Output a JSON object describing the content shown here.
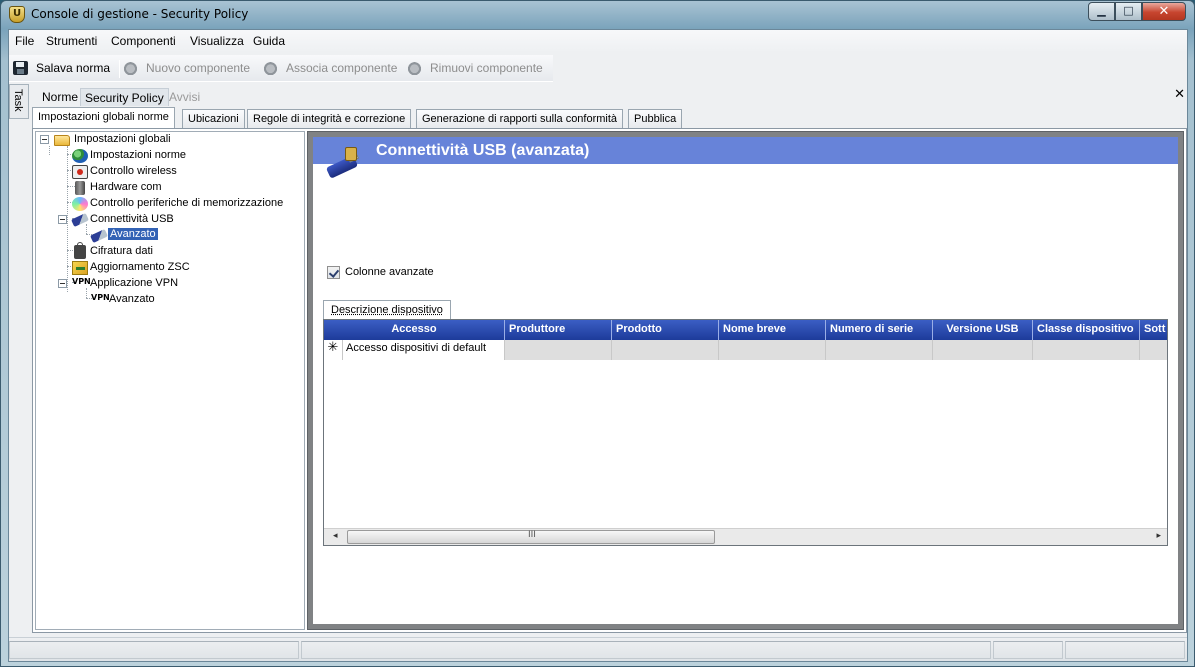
{
  "window": {
    "title": "Console di gestione  - Security Policy",
    "minimize_glyph": "▁",
    "maximize_glyph": "□",
    "close_glyph": "✕"
  },
  "menu": {
    "file": "File",
    "tools": "Strumenti",
    "components": "Componenti",
    "view": "Visualizza",
    "help": "Guida"
  },
  "toolbar": {
    "save": "Salava norma",
    "new_component": "Nuovo componente",
    "associate_component": "Associa componente",
    "remove_component": "Rimuovi componente"
  },
  "task_strip": "Task",
  "doc_tabs": {
    "policies": "Norme",
    "security_policy": "Security Policy",
    "alerts": "Avvisi",
    "close_glyph": "✕"
  },
  "tabs": {
    "global": "Impostazioni globali norme",
    "locations": "Ubicazioni",
    "integrity": "Regole di integrità e correzione",
    "compliance": "Generazione di rapporti sulla conformità",
    "publish": "Pubblica"
  },
  "tree": {
    "root": "Impostazioni globali",
    "policy_settings": "Impostazioni norme",
    "wireless": "Controllo wireless",
    "hardware": "Hardware com",
    "storage": "Controllo periferiche di memorizzazione",
    "usb": "Connettività USB",
    "usb_advanced": "Avanzato",
    "encryption": "Cifratura dati",
    "zsc_update": "Aggiornamento ZSC",
    "vpn": "Applicazione VPN",
    "vpn_advanced": "Avanzato",
    "vpn_glyph": "VPN"
  },
  "content": {
    "title": "Connettività USB (avanzata)",
    "advanced_columns": "Colonne avanzate",
    "advanced_columns_checked": true,
    "grid_tab": "Descrizione dispositivo",
    "columns": [
      "Accesso",
      "Produttore",
      "Prodotto",
      "Nome breve",
      "Numero di serie",
      "Versione USB",
      "Classe dispositivo",
      "Sott"
    ],
    "rows": [
      {
        "marker": "✳",
        "cells": [
          "Accesso dispositivi di default",
          "",
          "",
          "",
          "",
          "",
          "",
          ""
        ]
      }
    ],
    "scroll_left": "◂",
    "scroll_right": "▸",
    "scroll_grip": "III"
  }
}
